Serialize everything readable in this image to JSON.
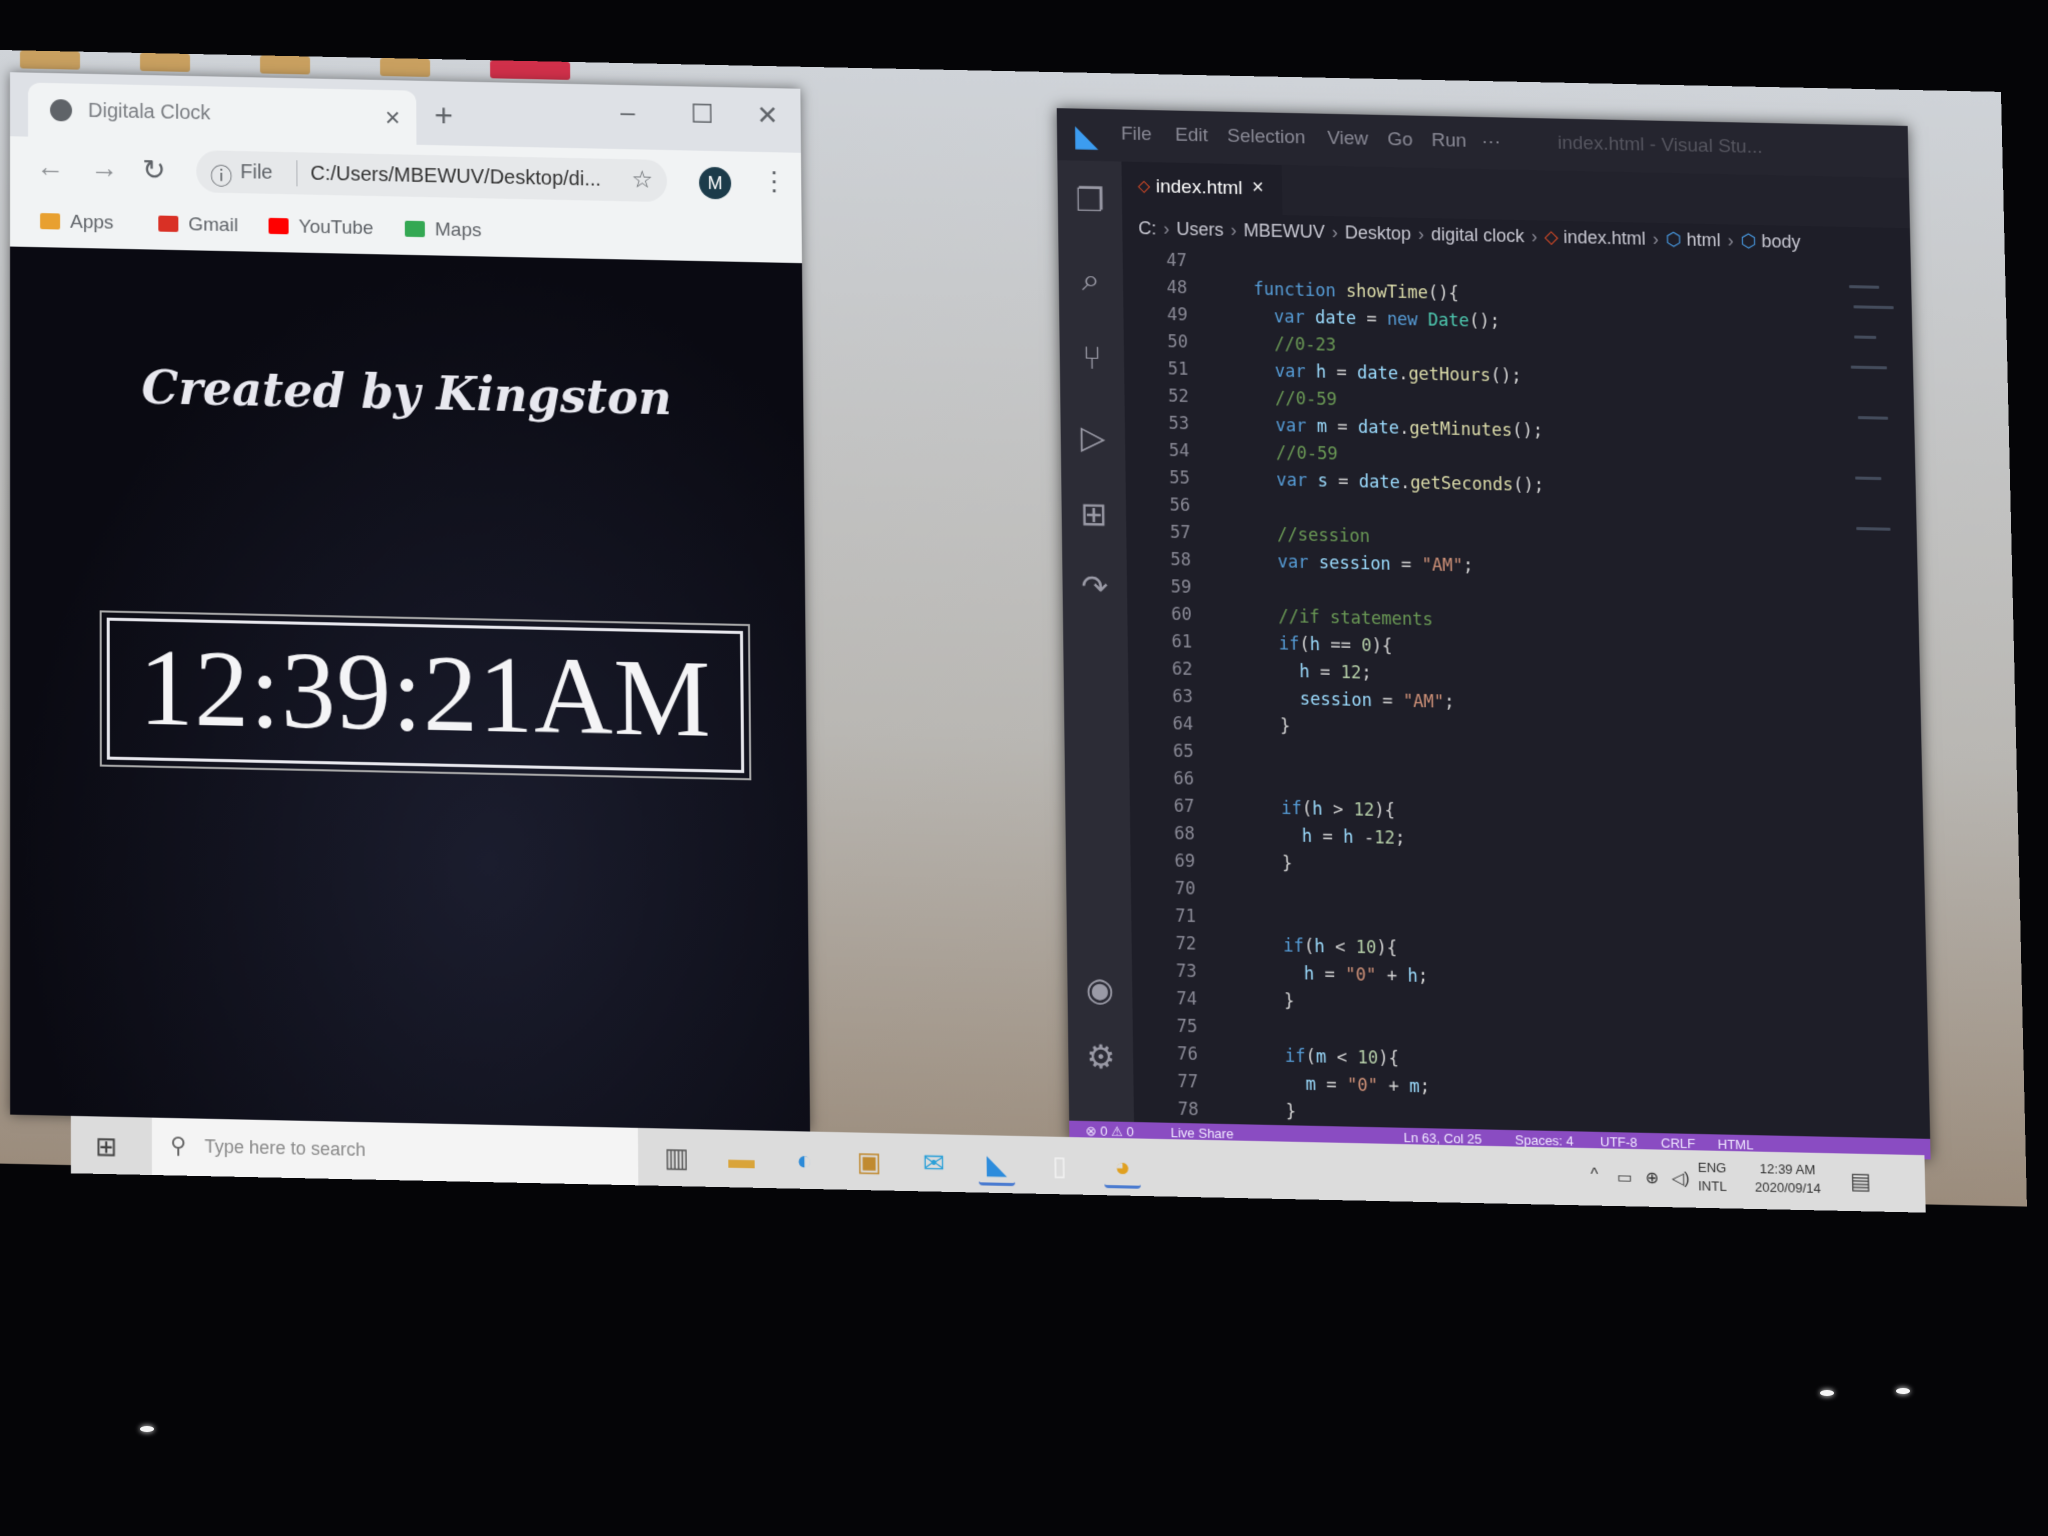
{
  "chrome": {
    "tab_title": "Digitala Clock",
    "tab_close": "×",
    "new_tab": "+",
    "minimize": "–",
    "maximize": "☐",
    "close": "✕",
    "back": "←",
    "forward": "→",
    "reload": "↻",
    "info_icon": "ⓘ",
    "scheme": "File",
    "url": "C:/Users/MBEWUV/Desktop/di...",
    "star": "☆",
    "profile_initial": "M",
    "menu": "⋮",
    "bookmarks": [
      {
        "label": "Apps",
        "icon": "apps-grid-icon",
        "color": "#e8a030"
      },
      {
        "label": "Gmail",
        "icon": "gmail-icon",
        "color": "#d93025"
      },
      {
        "label": "YouTube",
        "icon": "youtube-icon",
        "color": "#ff0000"
      },
      {
        "label": "Maps",
        "icon": "maps-icon",
        "color": "#34a853"
      }
    ]
  },
  "page": {
    "heading": "Created by Kingston",
    "clock": "12:39:21AM"
  },
  "vscode": {
    "menu": [
      "File",
      "Edit",
      "Selection",
      "View",
      "Go",
      "Run",
      "···"
    ],
    "title_faint": "index.html - Visual Stu...",
    "tab_name": "index.html",
    "tab_close": "×",
    "breadcrumb": [
      "C:",
      "Users",
      "MBEWUV",
      "Desktop",
      "digital clock",
      "index.html",
      "html",
      "body"
    ],
    "code_lines": [
      {
        "n": "47",
        "indent": 0,
        "parts": []
      },
      {
        "n": "48",
        "indent": 2,
        "parts": [
          [
            "kw",
            "function "
          ],
          [
            "fn",
            "showTime"
          ],
          [
            "pl",
            "(){"
          ]
        ]
      },
      {
        "n": "49",
        "indent": 4,
        "parts": [
          [
            "kw",
            "var "
          ],
          [
            "var",
            "date"
          ],
          [
            "pl",
            " = "
          ],
          [
            "kw",
            "new "
          ],
          [
            "ty",
            "Date"
          ],
          [
            "pl",
            "();"
          ]
        ]
      },
      {
        "n": "50",
        "indent": 4,
        "parts": [
          [
            "cm",
            "//0-23"
          ]
        ]
      },
      {
        "n": "51",
        "indent": 4,
        "parts": [
          [
            "kw",
            "var "
          ],
          [
            "var",
            "h"
          ],
          [
            "pl",
            " = "
          ],
          [
            "var",
            "date"
          ],
          [
            "pl",
            "."
          ],
          [
            "fn",
            "getHours"
          ],
          [
            "pl",
            "();"
          ]
        ]
      },
      {
        "n": "52",
        "indent": 4,
        "parts": [
          [
            "cm",
            "//0-59"
          ]
        ]
      },
      {
        "n": "53",
        "indent": 4,
        "parts": [
          [
            "kw",
            "var "
          ],
          [
            "var",
            "m"
          ],
          [
            "pl",
            " = "
          ],
          [
            "var",
            "date"
          ],
          [
            "pl",
            "."
          ],
          [
            "fn",
            "getMinutes"
          ],
          [
            "pl",
            "();"
          ]
        ]
      },
      {
        "n": "54",
        "indent": 4,
        "parts": [
          [
            "cm",
            "//0-59"
          ]
        ]
      },
      {
        "n": "55",
        "indent": 4,
        "parts": [
          [
            "kw",
            "var "
          ],
          [
            "var",
            "s"
          ],
          [
            "pl",
            " = "
          ],
          [
            "var",
            "date"
          ],
          [
            "pl",
            "."
          ],
          [
            "fn",
            "getSeconds"
          ],
          [
            "pl",
            "();"
          ]
        ]
      },
      {
        "n": "56",
        "indent": 0,
        "parts": []
      },
      {
        "n": "57",
        "indent": 4,
        "parts": [
          [
            "cm",
            "//session"
          ]
        ]
      },
      {
        "n": "58",
        "indent": 4,
        "parts": [
          [
            "kw",
            "var "
          ],
          [
            "var",
            "session"
          ],
          [
            "pl",
            " = "
          ],
          [
            "str",
            "\"AM\""
          ],
          [
            "pl",
            ";"
          ]
        ]
      },
      {
        "n": "59",
        "indent": 0,
        "parts": []
      },
      {
        "n": "60",
        "indent": 4,
        "parts": [
          [
            "cm",
            "//if statements"
          ]
        ]
      },
      {
        "n": "61",
        "indent": 4,
        "parts": [
          [
            "kw",
            "if"
          ],
          [
            "pl",
            "("
          ],
          [
            "var",
            "h"
          ],
          [
            "pl",
            " == "
          ],
          [
            "num",
            "0"
          ],
          [
            "pl",
            "){"
          ]
        ]
      },
      {
        "n": "62",
        "indent": 6,
        "parts": [
          [
            "var",
            "h"
          ],
          [
            "pl",
            " = "
          ],
          [
            "num",
            "12"
          ],
          [
            "pl",
            ";"
          ]
        ]
      },
      {
        "n": "63",
        "indent": 6,
        "parts": [
          [
            "var",
            "session"
          ],
          [
            "pl",
            " = "
          ],
          [
            "str",
            "\"AM\""
          ],
          [
            "pl",
            ";"
          ]
        ]
      },
      {
        "n": "64",
        "indent": 4,
        "parts": [
          [
            "pl",
            "}"
          ]
        ]
      },
      {
        "n": "65",
        "indent": 0,
        "parts": []
      },
      {
        "n": "66",
        "indent": 0,
        "parts": []
      },
      {
        "n": "67",
        "indent": 4,
        "parts": [
          [
            "kw",
            "if"
          ],
          [
            "pl",
            "("
          ],
          [
            "var",
            "h"
          ],
          [
            "pl",
            " > "
          ],
          [
            "num",
            "12"
          ],
          [
            "pl",
            "){"
          ]
        ]
      },
      {
        "n": "68",
        "indent": 6,
        "parts": [
          [
            "var",
            "h"
          ],
          [
            "pl",
            " = "
          ],
          [
            "var",
            "h"
          ],
          [
            "pl",
            " -"
          ],
          [
            "num",
            "12"
          ],
          [
            "pl",
            ";"
          ]
        ]
      },
      {
        "n": "69",
        "indent": 4,
        "parts": [
          [
            "pl",
            "}"
          ]
        ]
      },
      {
        "n": "70",
        "indent": 0,
        "parts": []
      },
      {
        "n": "71",
        "indent": 0,
        "parts": []
      },
      {
        "n": "72",
        "indent": 4,
        "parts": [
          [
            "kw",
            "if"
          ],
          [
            "pl",
            "("
          ],
          [
            "var",
            "h"
          ],
          [
            "pl",
            " < "
          ],
          [
            "num",
            "10"
          ],
          [
            "pl",
            "){"
          ]
        ]
      },
      {
        "n": "73",
        "indent": 6,
        "parts": [
          [
            "var",
            "h"
          ],
          [
            "pl",
            " = "
          ],
          [
            "str",
            "\"0\""
          ],
          [
            "pl",
            " + "
          ],
          [
            "var",
            "h"
          ],
          [
            "pl",
            ";"
          ]
        ]
      },
      {
        "n": "74",
        "indent": 4,
        "parts": [
          [
            "pl",
            "}"
          ]
        ]
      },
      {
        "n": "75",
        "indent": 0,
        "parts": []
      },
      {
        "n": "76",
        "indent": 4,
        "parts": [
          [
            "kw",
            "if"
          ],
          [
            "pl",
            "("
          ],
          [
            "var",
            "m"
          ],
          [
            "pl",
            " < "
          ],
          [
            "num",
            "10"
          ],
          [
            "pl",
            "){"
          ]
        ]
      },
      {
        "n": "77",
        "indent": 6,
        "parts": [
          [
            "var",
            "m"
          ],
          [
            "pl",
            " = "
          ],
          [
            "str",
            "\"0\""
          ],
          [
            "pl",
            " + "
          ],
          [
            "var",
            "m"
          ],
          [
            "pl",
            ";"
          ]
        ]
      },
      {
        "n": "78",
        "indent": 4,
        "parts": [
          [
            "pl",
            "}"
          ]
        ]
      }
    ],
    "status": {
      "problems": "⊗ 0 ⚠ 0",
      "live_share": "Live Share",
      "position": "Ln 63, Col 25",
      "spaces": "Spaces: 4",
      "encoding": "UTF-8",
      "eol": "CRLF",
      "language": "HTML"
    }
  },
  "taskbar": {
    "start_icon": "⊞",
    "search_placeholder": "Type here to search",
    "tray_up": "^",
    "lang_top": "ENG",
    "lang_bottom": "INTL",
    "time": "12:39 AM",
    "date": "2020/09/14",
    "notification_icon": "▤"
  },
  "colors": {
    "vscode_status": "#8a4cc2",
    "clock_text": "#f4f4f6",
    "accent_blue": "#3c9cf0"
  }
}
